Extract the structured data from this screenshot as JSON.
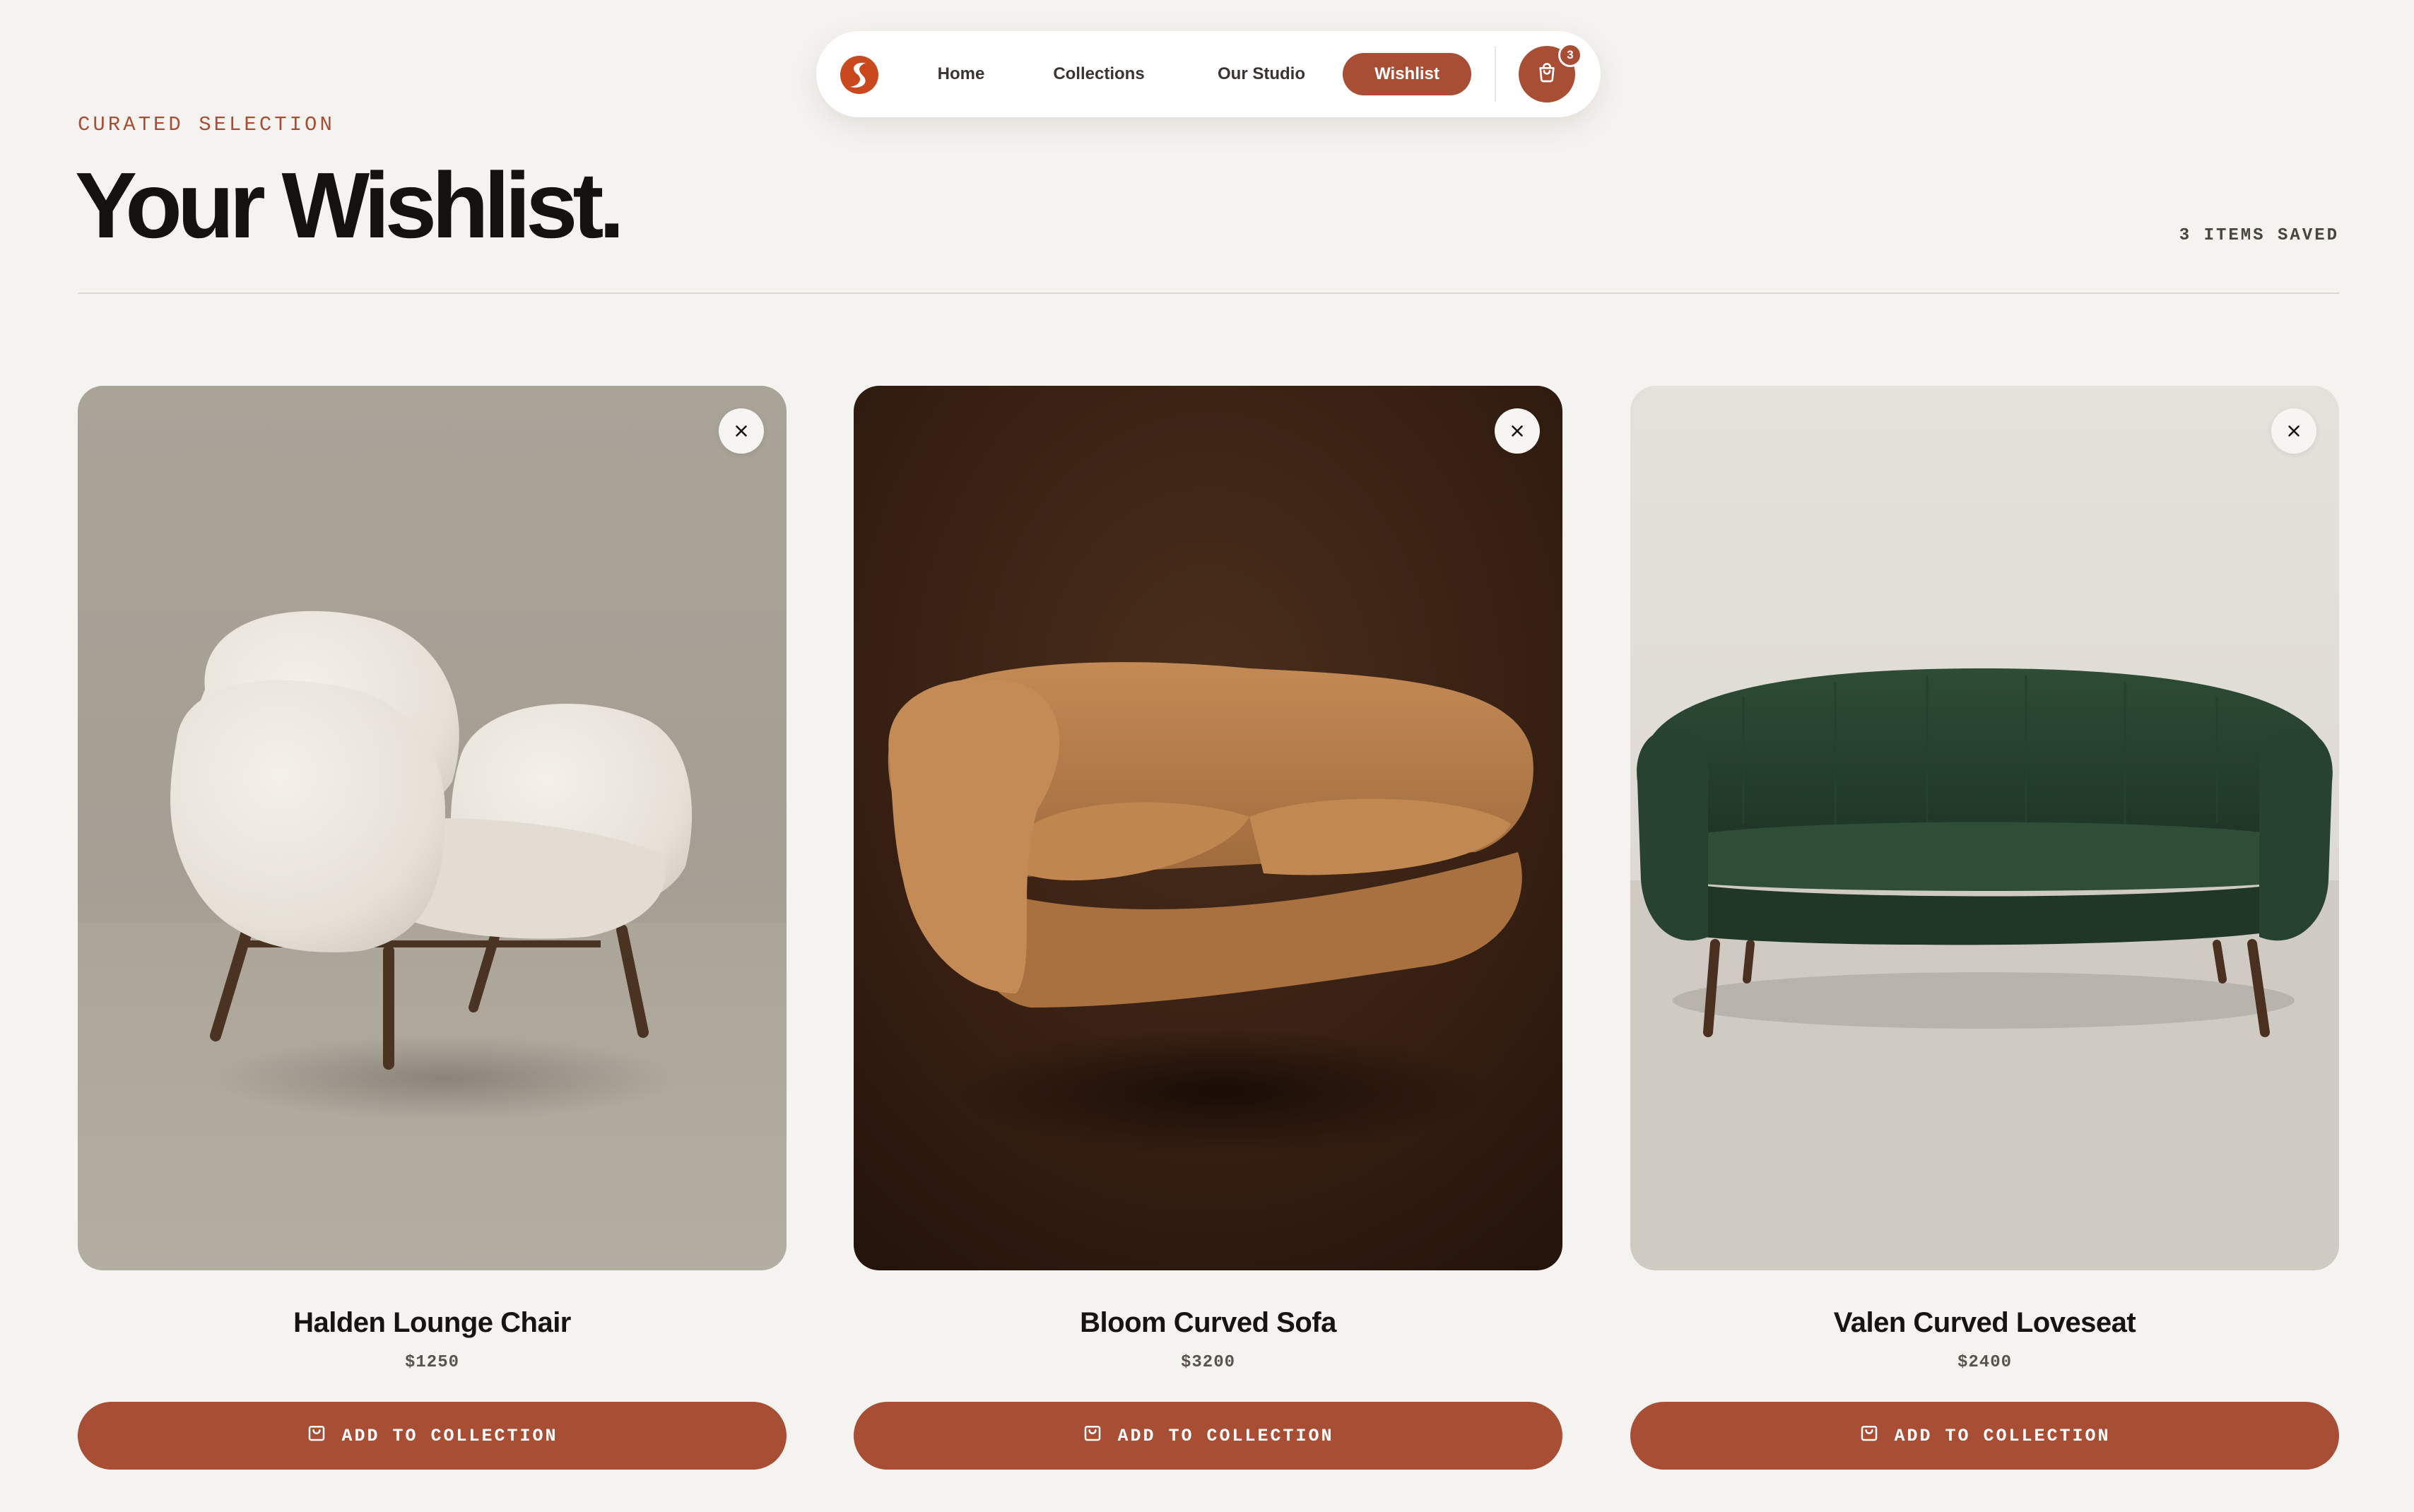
{
  "nav": {
    "logo_icon": "brand-s-logo-icon",
    "items": [
      {
        "label": "Home"
      },
      {
        "label": "Collections"
      },
      {
        "label": "Our Studio"
      },
      {
        "label": "Wishlist",
        "active": true
      }
    ],
    "cart_icon": "shopping-bag-icon",
    "cart_count": "3"
  },
  "header": {
    "eyebrow": "CURATED SELECTION",
    "title": "Your Wishlist.",
    "items_saved": "3 ITEMS SAVED"
  },
  "products": [
    {
      "name": "Halden Lounge Chair",
      "price": "$1250",
      "cta": "ADD TO COLLECTION",
      "image": "cream boucle lounge chair on wooden legs"
    },
    {
      "name": "Bloom Curved Sofa",
      "price": "$3200",
      "cta": "ADD TO COLLECTION",
      "image": "tan curved sofa on dark brown backdrop"
    },
    {
      "name": "Valen Curved Loveseat",
      "price": "$2400",
      "cta": "ADD TO COLLECTION",
      "image": "green velvet curved loveseat on wooden legs"
    }
  ],
  "colors": {
    "accent": "#a84e34",
    "background": "#f5f3f0",
    "text": "#161311"
  },
  "icons": {
    "remove": "close-icon",
    "add": "shopping-bag-icon"
  }
}
